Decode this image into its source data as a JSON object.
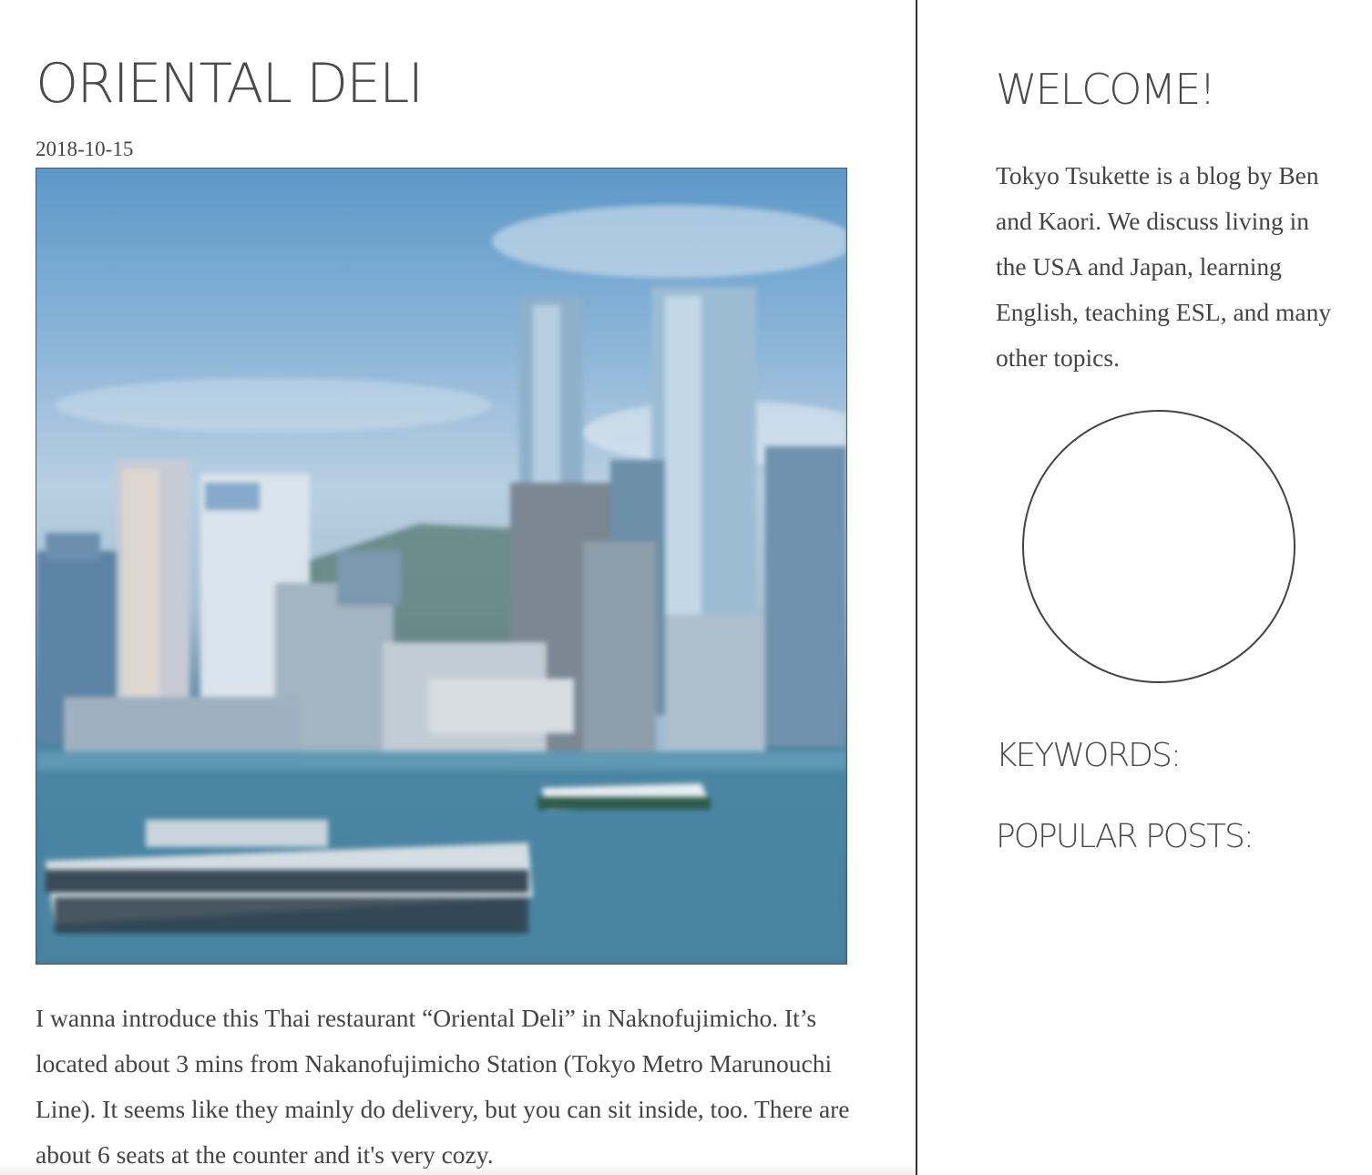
{
  "post": {
    "title": "ORIENTAL DELI",
    "date": "2018-10-15",
    "image_description_icon": "city-harbor-photo",
    "body": "I wanna introduce this Thai restaurant “Oriental Deli” in Naknofujimicho. It’s located about 3 mins from Nakanofujimicho Station (Tokyo Metro Marunouchi Line). It seems like they mainly do delivery, but you can sit inside, too. There are about 6 seats at the counter and it's very cozy."
  },
  "sidebar": {
    "welcome_title": "WELCOME!",
    "welcome_text": "Tokyo Tsukette is a blog by Ben and Kaori. We discuss living in the USA and Japan, learning English, teaching ESL, and many other topics.",
    "keywords_title": "KEYWORDS:",
    "popular_title": "POPULAR POSTS:"
  },
  "colors": {
    "text": "#444444",
    "divider": "#333333",
    "background": "#ffffff"
  }
}
